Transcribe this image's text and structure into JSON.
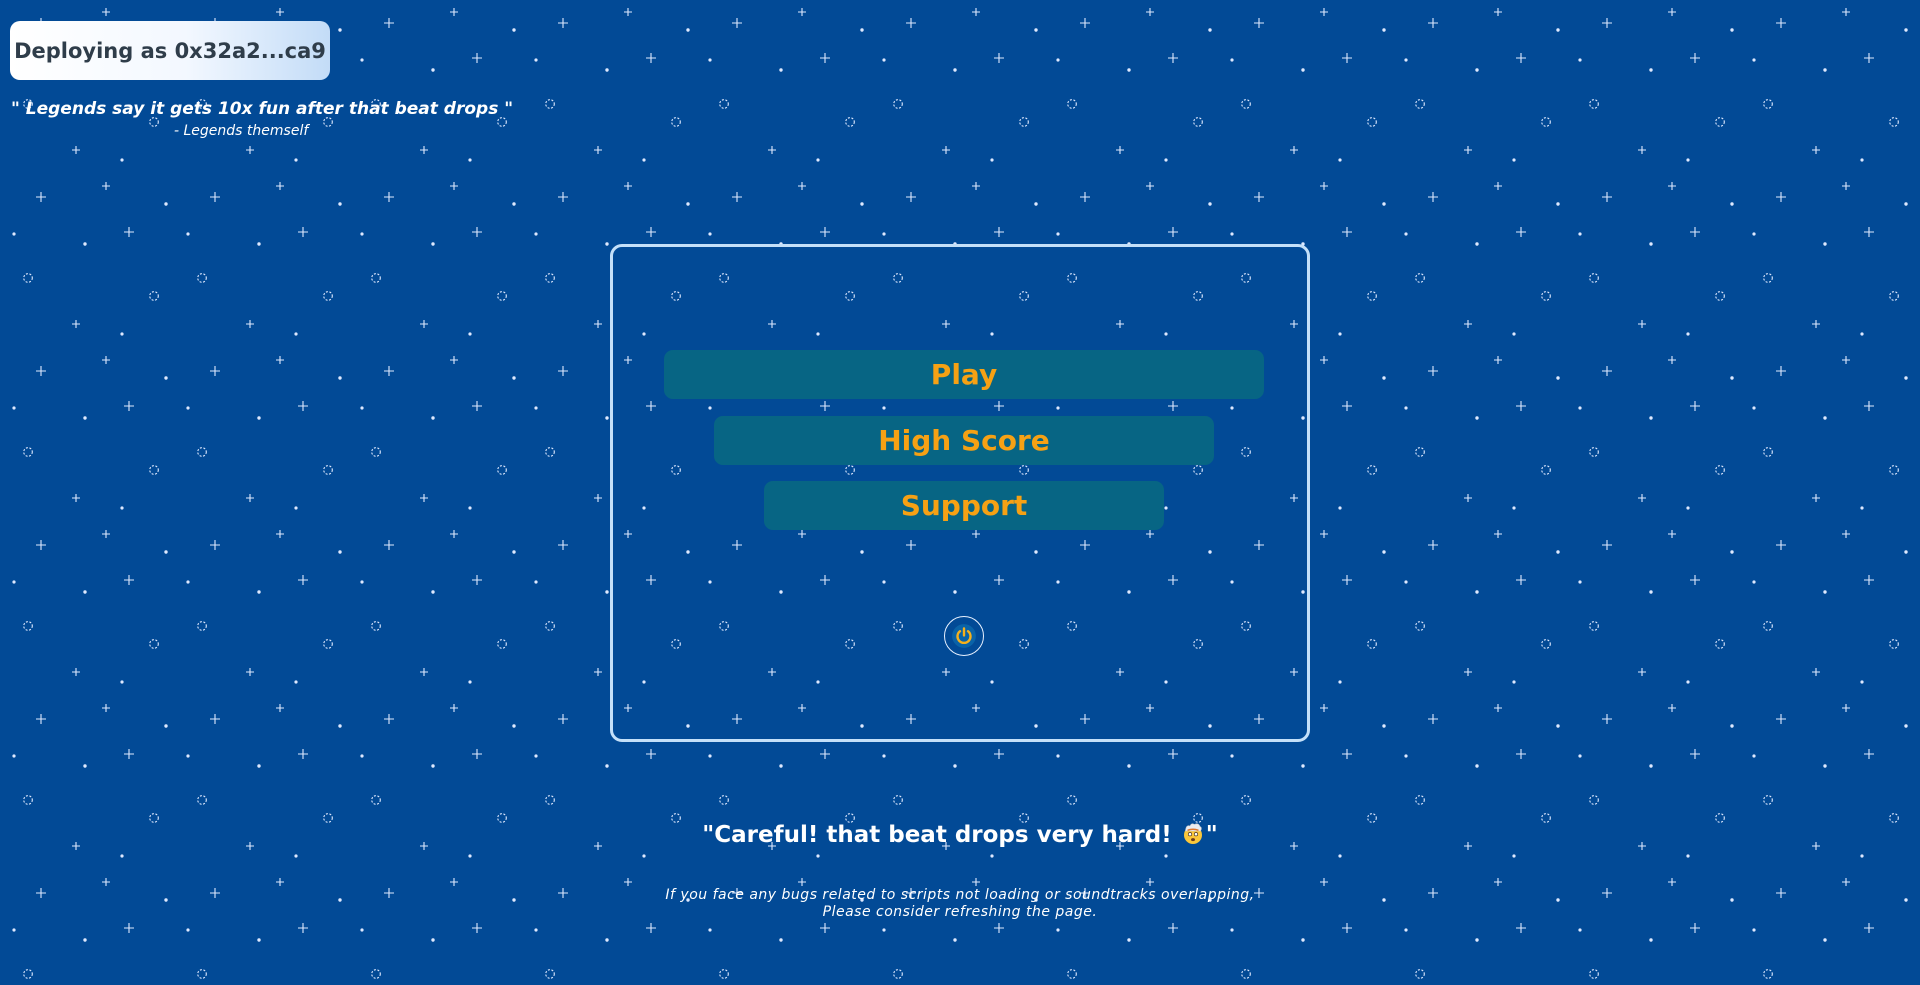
{
  "header": {
    "deploy_badge": "Deploying as 0x32a2...ca9"
  },
  "top_quote": {
    "text": "\" Legends say it gets 10x fun after that beat drops \"",
    "attribution": "- Legends themself"
  },
  "menu": {
    "play_label": "Play",
    "highscore_label": "High Score",
    "support_label": "Support",
    "power_icon": "power-icon"
  },
  "footer": {
    "warning_before": "\"Careful! that beat drops very hard! ",
    "warning_emoji": "exploding-head-emoji",
    "warning_after": "\"",
    "bug_note_line1": "If you face any bugs related to scripts not loading or soundtracks overlapping,",
    "bug_note_line2": "Please consider refreshing the page."
  },
  "colors": {
    "background": "#024a96",
    "button_bg": "#076584",
    "button_text": "#f6a114",
    "panel_border": "#c4e0f9"
  }
}
